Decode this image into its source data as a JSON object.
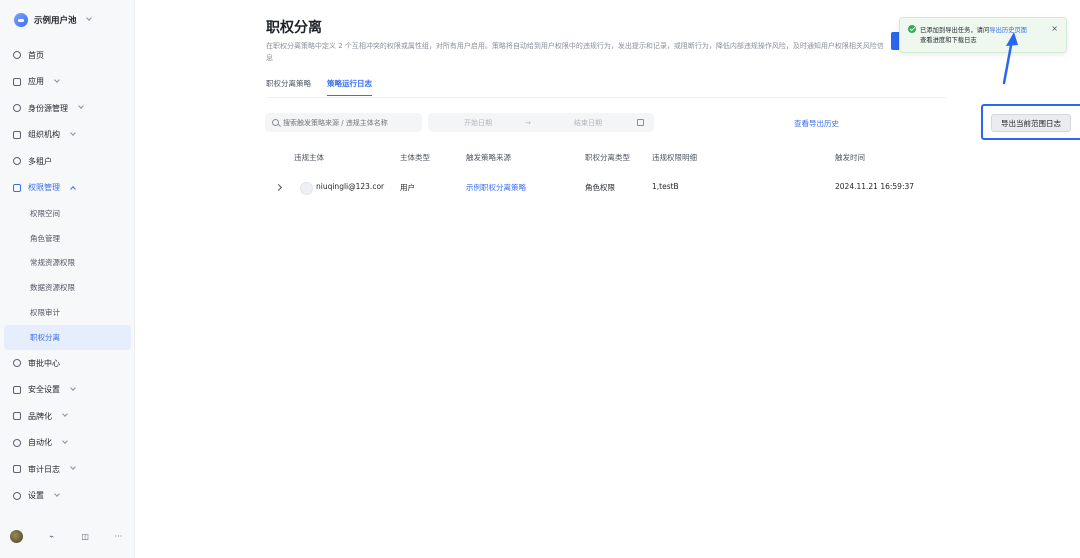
{
  "sidebar": {
    "brand": "示例用户池",
    "items": [
      {
        "label": "首页"
      },
      {
        "label": "应用"
      },
      {
        "label": "身份源管理"
      },
      {
        "label": "组织机构"
      },
      {
        "label": "多租户"
      },
      {
        "label": "权限管理"
      }
    ],
    "sub_items": [
      {
        "label": "权限空间"
      },
      {
        "label": "角色管理"
      },
      {
        "label": "常规资源权限"
      },
      {
        "label": "数据资源权限"
      },
      {
        "label": "权限审计"
      },
      {
        "label": "职权分离"
      }
    ],
    "items_after": [
      {
        "label": "审批中心"
      },
      {
        "label": "安全设置"
      },
      {
        "label": "品牌化"
      },
      {
        "label": "自动化"
      },
      {
        "label": "审计日志"
      },
      {
        "label": "设置"
      }
    ]
  },
  "page": {
    "title": "职权分离",
    "description": "在职权分离策略中定义 2 个互相冲突的权限或属性组，对所有用户启用。策略将自动给到用户权限中的违规行为，发出提示和记录，或阻断行为，降低内部违规操作风险，及时通知用户权限相关风险信息"
  },
  "tabs": [
    {
      "label": "职权分离策略"
    },
    {
      "label": "策略运行日志"
    }
  ],
  "toolbar": {
    "search_placeholder": "搜索触发策略来源 / 违规主体名称",
    "date_start_placeholder": "开始日期",
    "date_arrow": "→",
    "date_end_placeholder": "结束日期",
    "history_link": "查看导出历史",
    "export_button": "导出当前范围日志"
  },
  "table": {
    "columns": [
      "违规主体",
      "主体类型",
      "触发策略来源",
      "职权分离类型",
      "违规权限明细",
      "触发时间"
    ],
    "rows": [
      {
        "subject": "niuqingli@123.cor",
        "subject_type": "用户",
        "source": "示例职权分离策略",
        "sod_type": "角色权限",
        "detail": "1,testB",
        "time": "2024.11.21 16:59:37"
      }
    ]
  },
  "toast": {
    "text_prefix": "已添加到导出任务，请问",
    "link": "导出历史页面",
    "text_line2": "查看进度和下载日志",
    "close": "×"
  },
  "colors": {
    "accent": "#3a6df0",
    "highlight_border": "#2a66f0",
    "success": "#34a853"
  }
}
